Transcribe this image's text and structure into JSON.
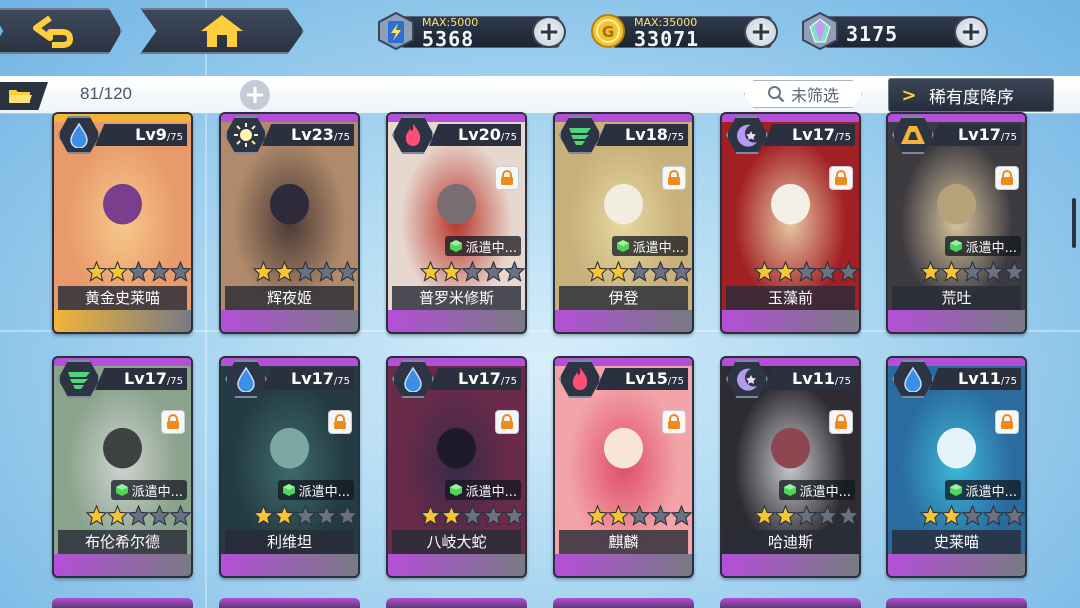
{
  "resources": {
    "energy": {
      "max_label": "MAX:5000",
      "value": "5368"
    },
    "coins": {
      "max_label": "MAX:35000",
      "value": "33071"
    },
    "crystals": {
      "value": "3175"
    }
  },
  "inventory": {
    "count": "81/120",
    "filter_label": "未筛选",
    "sort_label": "稀有度降序"
  },
  "cards": [
    {
      "name": "黄金史莱喵",
      "lv": "Lv9",
      "max": "/75",
      "element": "water",
      "rarity": "gold",
      "stars": 2,
      "locked": false,
      "dispatch": ""
    },
    {
      "name": "辉夜姬",
      "lv": "Lv23",
      "max": "/75",
      "element": "light",
      "rarity": "purple",
      "stars": 2,
      "locked": false,
      "dispatch": ""
    },
    {
      "name": "普罗米修斯",
      "lv": "Lv20",
      "max": "/75",
      "element": "fire",
      "rarity": "purple",
      "stars": 2,
      "locked": true,
      "dispatch": "派遣中..."
    },
    {
      "name": "伊登",
      "lv": "Lv18",
      "max": "/75",
      "element": "wind",
      "rarity": "purple",
      "stars": 2,
      "locked": true,
      "dispatch": "派遣中..."
    },
    {
      "name": "玉藻前",
      "lv": "Lv17",
      "max": "/75",
      "element": "dark",
      "rarity": "purple",
      "stars": 2,
      "locked": true,
      "dispatch": ""
    },
    {
      "name": "荒吐",
      "lv": "Lv17",
      "max": "/75",
      "element": "earth",
      "rarity": "purple",
      "stars": 2,
      "locked": true,
      "dispatch": "派遣中..."
    },
    {
      "name": "布伦希尔德",
      "lv": "Lv17",
      "max": "/75",
      "element": "wind",
      "rarity": "purple",
      "stars": 2,
      "locked": true,
      "dispatch": "派遣中..."
    },
    {
      "name": "利维坦",
      "lv": "Lv17",
      "max": "/75",
      "element": "water",
      "rarity": "purple",
      "stars": 2,
      "locked": true,
      "dispatch": "派遣中..."
    },
    {
      "name": "八岐大蛇",
      "lv": "Lv17",
      "max": "/75",
      "element": "water",
      "rarity": "purple",
      "stars": 2,
      "locked": true,
      "dispatch": "派遣中..."
    },
    {
      "name": "麒麟",
      "lv": "Lv15",
      "max": "/75",
      "element": "fire",
      "rarity": "purple",
      "stars": 2,
      "locked": true,
      "dispatch": ""
    },
    {
      "name": "哈迪斯",
      "lv": "Lv11",
      "max": "/75",
      "element": "dark",
      "rarity": "purple",
      "stars": 2,
      "locked": true,
      "dispatch": "派遣中..."
    },
    {
      "name": "史莱喵",
      "lv": "Lv11",
      "max": "/75",
      "element": "water",
      "rarity": "purple",
      "stars": 2,
      "locked": true,
      "dispatch": "派遣中..."
    }
  ],
  "colors": {
    "gold_rarity": "#f2b53a",
    "purple_rarity": "#b44fd8",
    "star_on": "#f7c630",
    "star_off": "#6a7180"
  },
  "icons": {
    "back": "back-arrow-icon",
    "home": "home-icon",
    "energy": "energy-battery-icon",
    "coin": "gold-coin-icon",
    "crystal": "crystal-gem-icon",
    "folder": "folder-icon",
    "search": "search-icon",
    "lock": "lock-icon",
    "dispatch": "dispatch-cube-icon"
  }
}
